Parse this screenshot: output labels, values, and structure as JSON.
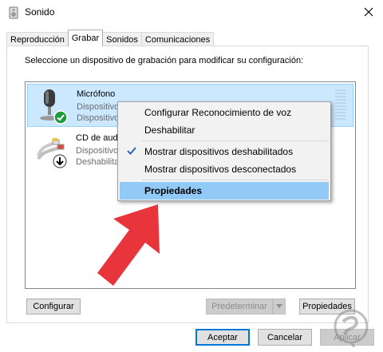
{
  "window": {
    "title": "Sonido"
  },
  "tabs": [
    {
      "label": "Reproducción",
      "active": false
    },
    {
      "label": "Grabar",
      "active": true
    },
    {
      "label": "Sonidos",
      "active": false
    },
    {
      "label": "Comunicaciones",
      "active": false
    }
  ],
  "instructions": "Seleccione un dispositivo de grabación para modificar su configuración:",
  "devices": [
    {
      "name": "Micrófono",
      "line1": "Dispositivo",
      "line2": "Dispositivo",
      "icon": "microphone-icon",
      "status_icon": "checkmark-badge-icon",
      "selected": true
    },
    {
      "name": "CD de aud",
      "line1": "Dispositivo",
      "line2": "Deshabilitado",
      "icon": "rca-cable-icon",
      "status_icon": "down-arrow-badge-icon",
      "selected": false
    }
  ],
  "context_menu": {
    "items": [
      {
        "label": "Configurar Reconocimiento de voz",
        "checked": false
      },
      {
        "label": "Deshabilitar",
        "checked": false
      },
      {
        "label": "Mostrar dispositivos deshabilitados",
        "checked": true
      },
      {
        "label": "Mostrar dispositivos desconectados",
        "checked": false
      },
      {
        "label": "Propiedades",
        "highlighted": true
      }
    ]
  },
  "panel_buttons": {
    "configure": "Configurar",
    "set_default": "Predeterminar",
    "properties": "Propiedades"
  },
  "dialog_buttons": {
    "accept": "Aceptar",
    "cancel": "Cancelar",
    "apply": "Aplicar"
  },
  "colors": {
    "selection": "#cce8ff",
    "menu_highlight": "#91c9f7",
    "arrow": "#e8343b",
    "ok_green": "#1e9c3c"
  }
}
